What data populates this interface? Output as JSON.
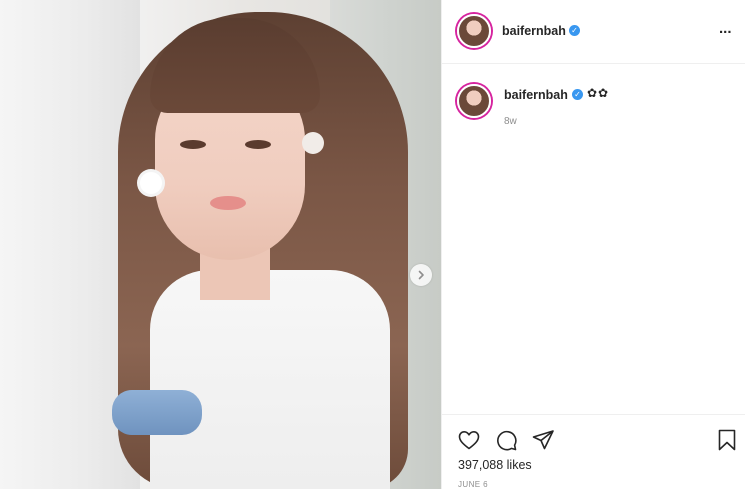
{
  "post": {
    "image_alt": "photo",
    "carousel_next": "next"
  },
  "header": {
    "username": "baifernbah",
    "more": "..."
  },
  "caption": {
    "username": "baifernbah",
    "text": "✿✿",
    "time": "8w"
  },
  "actions": {
    "like_icon": "heart-icon",
    "comment_icon": "comment-icon",
    "share_icon": "paper-plane-icon",
    "save_icon": "bookmark-icon"
  },
  "stats": {
    "likes": "397,088 likes",
    "date": "JUNE 6"
  },
  "colors": {
    "verified": "#3897f0",
    "story_ring": "#d6249f",
    "muted_text": "#8e8e8e"
  }
}
